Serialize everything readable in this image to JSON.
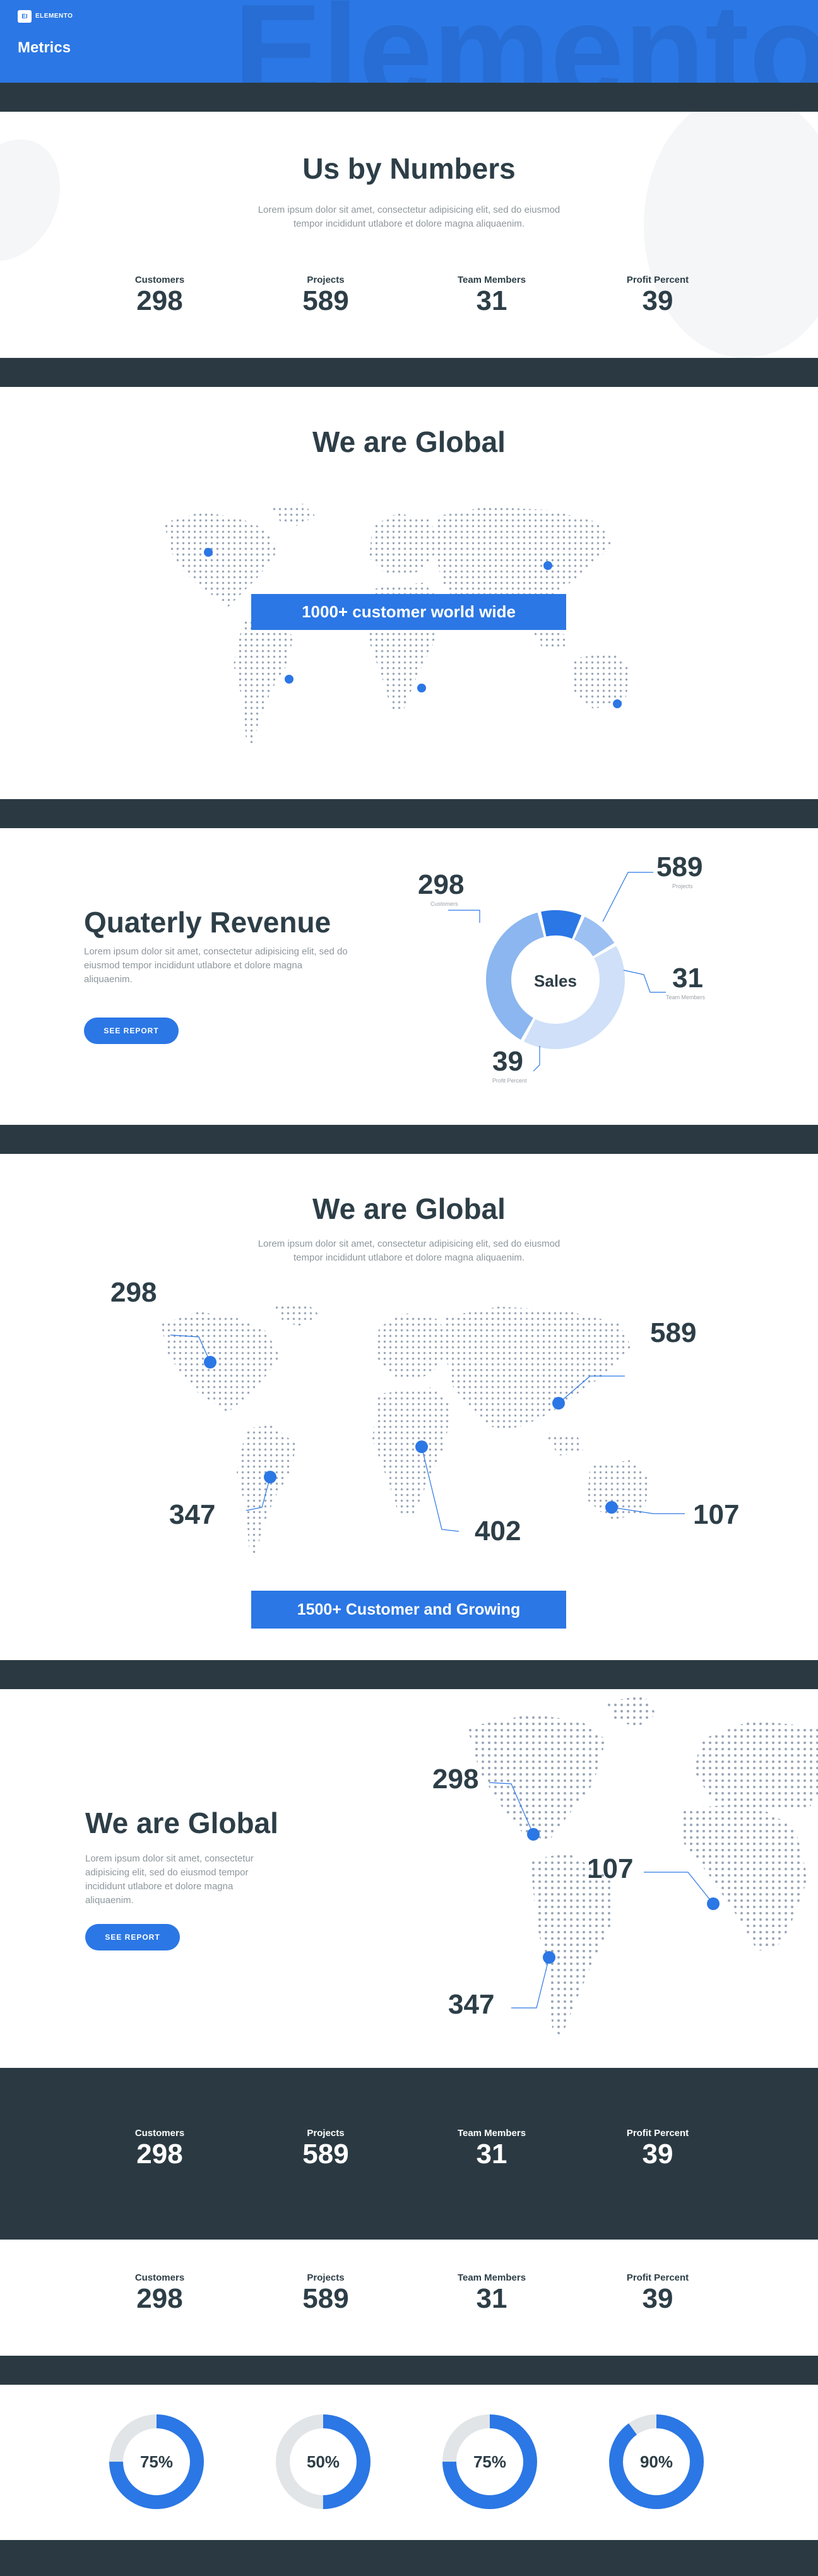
{
  "header": {
    "brand_badge": "EI",
    "brand_name": "ELEMENTO",
    "title": "Metrics",
    "watermark": "Elemento",
    "accent": "#2b77e5"
  },
  "numbers": {
    "title": "Us by Numbers",
    "desc": "Lorem ipsum dolor sit amet, consectetur adipisicing elit, sed do eiusmod tempor incididunt utlabore et dolore magna aliquaenim.",
    "stats": [
      {
        "label": "Customers",
        "value": "298"
      },
      {
        "label": "Projects",
        "value": "589"
      },
      {
        "label": "Team Members",
        "value": "31"
      },
      {
        "label": "Profit Percent",
        "value": "39"
      }
    ]
  },
  "global1": {
    "title": "We are Global",
    "banner": "1000+ customer world wide"
  },
  "revenue": {
    "title": "Quaterly Revenue",
    "desc": "Lorem ipsum dolor sit amet, consectetur adipisicing elit, sed do eiusmod tempor incididunt utlabore et dolore magna aliquaenim.",
    "button": "SEE REPORT",
    "donut_center": "Sales",
    "callouts": [
      {
        "value": "298",
        "label": "Customers"
      },
      {
        "value": "589",
        "label": "Projects"
      },
      {
        "value": "31",
        "label": "Team Members"
      },
      {
        "value": "39",
        "label": "Profit Percent"
      }
    ]
  },
  "global2": {
    "title": "We are Global",
    "desc": "Lorem ipsum dolor sit amet, consectetur adipisicing elit, sed do eiusmod tempor incididunt utlabore et dolore magna aliquaenim.",
    "markers": [
      "298",
      "589",
      "347",
      "402",
      "107"
    ],
    "banner": "1500+ Customer and Growing"
  },
  "global3": {
    "title": "We are Global",
    "desc": "Lorem ipsum dolor sit amet, consectetur adipisicing elit, sed do eiusmod tempor incididunt utlabore et dolore magna aliquaenim.",
    "button": "SEE REPORT",
    "markers": [
      "298",
      "107",
      "347"
    ]
  },
  "stats_dark": [
    {
      "label": "Customers",
      "value": "298"
    },
    {
      "label": "Projects",
      "value": "589"
    },
    {
      "label": "Team Members",
      "value": "31"
    },
    {
      "label": "Profit Percent",
      "value": "39"
    }
  ],
  "stats_light": [
    {
      "label": "Customers",
      "value": "298"
    },
    {
      "label": "Projects",
      "value": "589"
    },
    {
      "label": "Team Members",
      "value": "31"
    },
    {
      "label": "Profit Percent",
      "value": "39"
    }
  ],
  "progress": [
    {
      "label": "75%",
      "value": 0.75
    },
    {
      "label": "50%",
      "value": 0.5
    },
    {
      "label": "75%",
      "value": 0.75
    },
    {
      "label": "90%",
      "value": 0.9
    }
  ]
}
